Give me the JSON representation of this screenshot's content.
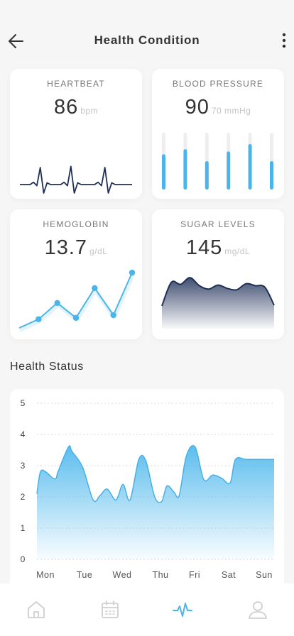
{
  "header": {
    "title": "Health Condition",
    "back_icon": "arrow-left-icon",
    "more_icon": "more-vertical-icon"
  },
  "cards": {
    "heartbeat": {
      "label": "HEARTBEAT",
      "value": "86",
      "unit": "bpm"
    },
    "blood_pressure": {
      "label": "BLOOD PRESSURE",
      "value": "90",
      "unit": "70 mmHg"
    },
    "hemoglobin": {
      "label": "HEMOGLOBIN",
      "value": "13.7",
      "unit": "g/dL"
    },
    "sugar_levels": {
      "label": "SUGAR LEVELS",
      "value": "145",
      "unit": "mg/dL"
    }
  },
  "health_status": {
    "title": "Health Status"
  },
  "chart_data": [
    {
      "type": "line",
      "title": "",
      "description_source": "HEARTBEAT card sparkline",
      "x": [
        0,
        1,
        2,
        3,
        4,
        5,
        6,
        7,
        8,
        9,
        10,
        11,
        12,
        13,
        14,
        15,
        16,
        17,
        18,
        19,
        20,
        21,
        22,
        23,
        24,
        25,
        26,
        27,
        28,
        29,
        30,
        31,
        32,
        33
      ],
      "values": [
        0,
        0,
        0,
        0,
        0.4,
        -0.2,
        3,
        -1.5,
        0.3,
        0,
        0,
        0,
        0,
        0.4,
        -0.2,
        3.2,
        -1.5,
        0.3,
        0,
        0,
        0,
        0,
        0,
        0.4,
        -0.2,
        3,
        -1.5,
        0.3,
        0,
        0,
        0,
        0,
        0,
        0
      ],
      "color": "#1e2f57"
    },
    {
      "type": "bar",
      "title": "",
      "description_source": "BLOOD PRESSURE card bars",
      "categories": [
        "1",
        "2",
        "3",
        "4",
        "5",
        "6"
      ],
      "values": [
        0.62,
        0.71,
        0.5,
        0.67,
        0.8,
        0.5
      ],
      "ylim": [
        0,
        1
      ],
      "color": "#4bb5eb",
      "track_color": "#eeeeee"
    },
    {
      "type": "line",
      "title": "",
      "description_source": "HEMOGLOBIN card line",
      "x": [
        0,
        1,
        2,
        3,
        4,
        5,
        6
      ],
      "values": [
        0,
        1.3,
        3.7,
        1.5,
        5.9,
        1.9,
        8.2
      ],
      "markers": [
        1,
        2,
        3,
        4,
        5,
        6
      ],
      "color": "#4bb5eb"
    },
    {
      "type": "area",
      "title": "",
      "description_source": "SUGAR LEVELS card area",
      "x": [
        0,
        1,
        2,
        3,
        4,
        5,
        6,
        7,
        8,
        9,
        10,
        11,
        12
      ],
      "values": [
        2.0,
        5.5,
        5.2,
        6.2,
        5.0,
        4.5,
        5.1,
        4.6,
        4.4,
        5.3,
        5.0,
        4.8,
        2.1
      ],
      "color": "#1e2f57"
    },
    {
      "type": "area",
      "title": "",
      "xlabel": "",
      "ylabel": "",
      "categories": [
        "Mon",
        "Tue",
        "Wed",
        "Thu",
        "Fri",
        "Sat",
        "Sun"
      ],
      "ylim": [
        0,
        5
      ],
      "yticks": [
        0,
        1,
        2,
        3,
        4,
        5
      ],
      "grid": true,
      "x": [
        0,
        0.1,
        0.25,
        0.45,
        0.55,
        0.6,
        0.9,
        1.0,
        1.3,
        1.6,
        1.8,
        2.0,
        2.25,
        2.45,
        2.65,
        2.9,
        3.1,
        3.35,
        3.55,
        3.7,
        3.9,
        4.05,
        4.25,
        4.5,
        4.75,
        5.0,
        5.25,
        5.5,
        5.65,
        5.95,
        6.2,
        6.45,
        6.75
      ],
      "values": [
        2.1,
        2.8,
        2.8,
        2.6,
        2.6,
        2.8,
        3.6,
        3.45,
        2.95,
        1.9,
        2.05,
        2.25,
        1.9,
        2.4,
        1.9,
        3.2,
        3.15,
        2.0,
        1.85,
        2.35,
        2.15,
        2.05,
        3.3,
        3.6,
        2.55,
        2.7,
        2.6,
        2.45,
        3.2,
        3.2,
        3.2,
        3.2,
        3.2
      ],
      "color": "#5bbdee"
    }
  ],
  "bottom_nav": [
    {
      "icon": "home-icon",
      "active": false
    },
    {
      "icon": "calendar-icon",
      "active": false
    },
    {
      "icon": "activity-icon",
      "active": true
    },
    {
      "icon": "user-icon",
      "active": false
    }
  ],
  "colors": {
    "accent": "#4bb5eb",
    "dark_accent": "#1e2f57",
    "nav_inactive": "#cfcfcf"
  }
}
